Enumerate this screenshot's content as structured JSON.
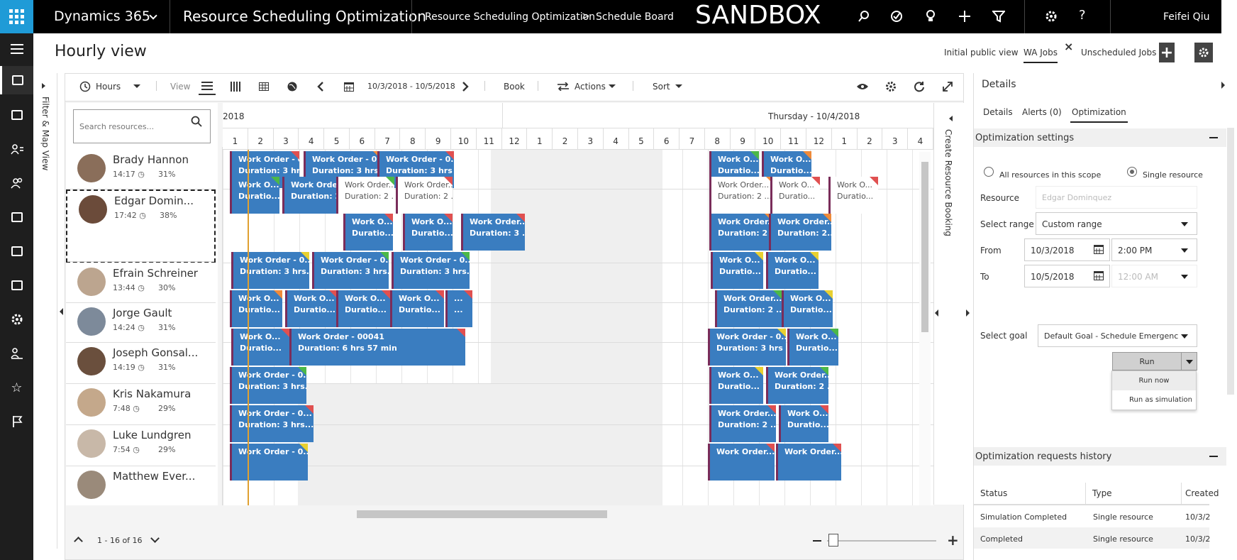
{
  "topbar": {
    "app_name": "Dynamics 365",
    "module": "Resource Scheduling Optimization",
    "crumb1": "Resource Scheduling Optimization",
    "crumb_sep": ">",
    "crumb2": "Schedule Board",
    "env": "SANDBOX",
    "user": "Feifei Qiu"
  },
  "page": {
    "title": "Hourly view",
    "tabs": [
      "Initial public view",
      "WA Jobs",
      "Unscheduled Jobs"
    ],
    "active_tab": "WA Jobs",
    "close": "×",
    "add": "+"
  },
  "filter_panel": {
    "label": "Filter & Map View"
  },
  "toolbar": {
    "hours": "Hours",
    "view": "View",
    "date_range": "10/3/2018 - 10/5/2018",
    "book": "Book",
    "actions": "Actions",
    "sort": "Sort"
  },
  "search": {
    "placeholder": "Search resources..."
  },
  "timeline": {
    "day1": "2018",
    "day2": "Thursday - 10/4/2018",
    "hours": [
      "1",
      "2",
      "3",
      "4",
      "5",
      "6",
      "7",
      "8",
      "9",
      "10",
      "11",
      "12",
      "1",
      "2",
      "3",
      "4",
      "5",
      "6",
      "7",
      "8",
      "9",
      "10",
      "11",
      "12",
      "1",
      "2",
      "3",
      "4"
    ]
  },
  "resources": [
    {
      "name": "Brady Hannon",
      "time": "14:17",
      "pct": "31%"
    },
    {
      "name": "Edgar Domin...",
      "time": "17:42",
      "pct": "38%"
    },
    {
      "name": "Efrain Schreiner",
      "time": "13:44",
      "pct": "30%"
    },
    {
      "name": "Jorge Gault",
      "time": "14:24",
      "pct": "31%"
    },
    {
      "name": "Joseph Gonsal...",
      "time": "14:19",
      "pct": "31%"
    },
    {
      "name": "Kris Nakamura",
      "time": "7:48",
      "pct": "29%"
    },
    {
      "name": "Luke Lundgren",
      "time": "7:54",
      "pct": "29%"
    },
    {
      "name": "Matthew Ever...",
      "time": "",
      "pct": ""
    }
  ],
  "bookings": [
    [
      "Work Order - 0...",
      "Duration: 3 hrs...",
      "#e05050",
      0,
      "b"
    ],
    [
      "Work Order - 0...",
      "Duration: 3 hrs...",
      "#ee8a3a",
      0,
      "b"
    ],
    [
      "Work Order - 0...",
      "Duration: 3 hrs ...",
      "#e05050",
      0,
      "b"
    ],
    [
      "Work O...",
      "Duratio...",
      "#4cb848",
      0,
      "b"
    ],
    [
      "Work O...",
      "Duratio...",
      "#ee8a3a",
      0,
      "b"
    ],
    [
      "Work O...",
      "Duratio...",
      "#4cb848",
      1,
      "b"
    ],
    [
      "Work Orde...",
      "Duration: 2...",
      "#ee8a3a",
      1,
      "b"
    ],
    [
      "Work Order...",
      "Duration: 2 ...",
      "#4cb848",
      1,
      "w"
    ],
    [
      "Work Order...",
      "Duration: 2 ...",
      "#e05050",
      1,
      "w"
    ],
    [
      "Work Order...",
      "Duration: 2 ...",
      "#ee8a3a",
      1,
      "w"
    ],
    [
      "Work O...",
      "Duratio...",
      "#e05050",
      1,
      "w"
    ],
    [
      "Work O...",
      "Duratio...",
      "#e05050",
      1,
      "w"
    ],
    [
      "Work O...",
      "Duratio...",
      "#e05050",
      2,
      "b"
    ],
    [
      "Work O...",
      "Duratio...",
      "#e05050",
      2,
      "b"
    ],
    [
      "Work Order...",
      "Duration: 3 ...",
      "#e05050",
      2,
      "b"
    ],
    [
      "Work Order...",
      "Duration: 2 ...",
      "#ee8a3a",
      2,
      "b"
    ],
    [
      "Work Order...",
      "Duration: 2...",
      "#ee8a3a",
      2,
      "b"
    ],
    [
      "Work Order - 0...",
      "Duration: 3 hrs...",
      "#e8d030",
      3,
      "b"
    ],
    [
      "Work Order - 0...",
      "Duration: 3 hrs...",
      "#4cb848",
      3,
      "b"
    ],
    [
      "Work Order - 0...",
      "Duration: 3 hrs...",
      "#4cb848",
      3,
      "b"
    ],
    [
      "Work O...",
      "Duratio...",
      "#e8d030",
      3,
      "b"
    ],
    [
      "Work O...",
      "Duratio...",
      "#e8d030",
      3,
      "b"
    ],
    [
      "Work O...",
      "Duratio...",
      "#ee8a3a",
      4,
      "b"
    ],
    [
      "Work O...",
      "Duratio...",
      "#e05050",
      4,
      "b"
    ],
    [
      "Work O...",
      "Duratio...",
      "#e05050",
      4,
      "b"
    ],
    [
      "Work O...",
      "Duratio...",
      "#e05050",
      4,
      "b"
    ],
    [
      "...",
      "...",
      "#e05050",
      4,
      "b"
    ],
    [
      "Work Order...",
      "Duration: 2 ...",
      "#4cb848",
      4,
      "b"
    ],
    [
      "Work O...",
      "Duratio...",
      "#e8d030",
      4,
      "b"
    ],
    [
      "Work O...",
      "Duratio...",
      "#e05050",
      5,
      "b"
    ],
    [
      "Work Order - 00041",
      "Duration: 6 hrs 57 min",
      "#e05050",
      5,
      "b"
    ],
    [
      "Work Order - 0...",
      "Duration: 3 hrs ...",
      "#e8d030",
      5,
      "b"
    ],
    [
      "Work O...",
      "Duratio...",
      "#4cb848",
      5,
      "b"
    ],
    [
      "Work Order - 0...",
      "Duration: 3 hrs...",
      "#4cb848",
      6,
      "b"
    ],
    [
      "Work O...",
      "Duratio...",
      "#e8d030",
      6,
      "b"
    ],
    [
      "Work Order...",
      "Duration: 2 ...",
      "#4cb848",
      6,
      "b"
    ],
    [
      "Work Order - 0...",
      "Duration: 3 hrs...",
      "#e05050",
      7,
      "b"
    ],
    [
      "Work Order...",
      "Duration: 2 ...",
      "#e05050",
      7,
      "b"
    ],
    [
      "Work O...",
      "Duratio...",
      "#e05050",
      7,
      "b"
    ],
    [
      "Work Order - 0...",
      "",
      "#e8d030",
      8,
      "b"
    ],
    [
      "Work Order...",
      "",
      "#e05050",
      8,
      "b"
    ],
    [
      "Work Order...",
      "",
      "#e05050",
      8,
      "b"
    ]
  ],
  "pager": {
    "range": "1 - 16 of 16"
  },
  "create_booking": {
    "label": "Create Resource Booking"
  },
  "details": {
    "title": "Details",
    "tabs": [
      "Details",
      "Alerts (0)",
      "Optimization"
    ],
    "active": "Optimization",
    "opt_settings": "Optimization settings",
    "scope_all": "All resources in this scope",
    "scope_single": "Single resource",
    "resource_label": "Resource",
    "resource_value": "Edgar Dominquez",
    "range_label": "Select range",
    "range_value": "Custom range",
    "from_label": "From",
    "from_date": "10/3/2018",
    "from_time": "2:00 PM",
    "to_label": "To",
    "to_date": "10/5/2018",
    "to_time": "12:00 AM",
    "goal_label": "Select goal",
    "goal_value": "Default Goal - Schedule Emergenc",
    "run": "Run",
    "run_now": "Run now",
    "run_sim": "Run as simulation",
    "history": "Optimization requests history",
    "cols": [
      "Status",
      "Type",
      "Created"
    ],
    "rows": [
      [
        "Simulation Completed",
        "Single resource",
        "10/3/2"
      ],
      [
        "Completed",
        "Single resource",
        "10/3/2"
      ]
    ]
  }
}
